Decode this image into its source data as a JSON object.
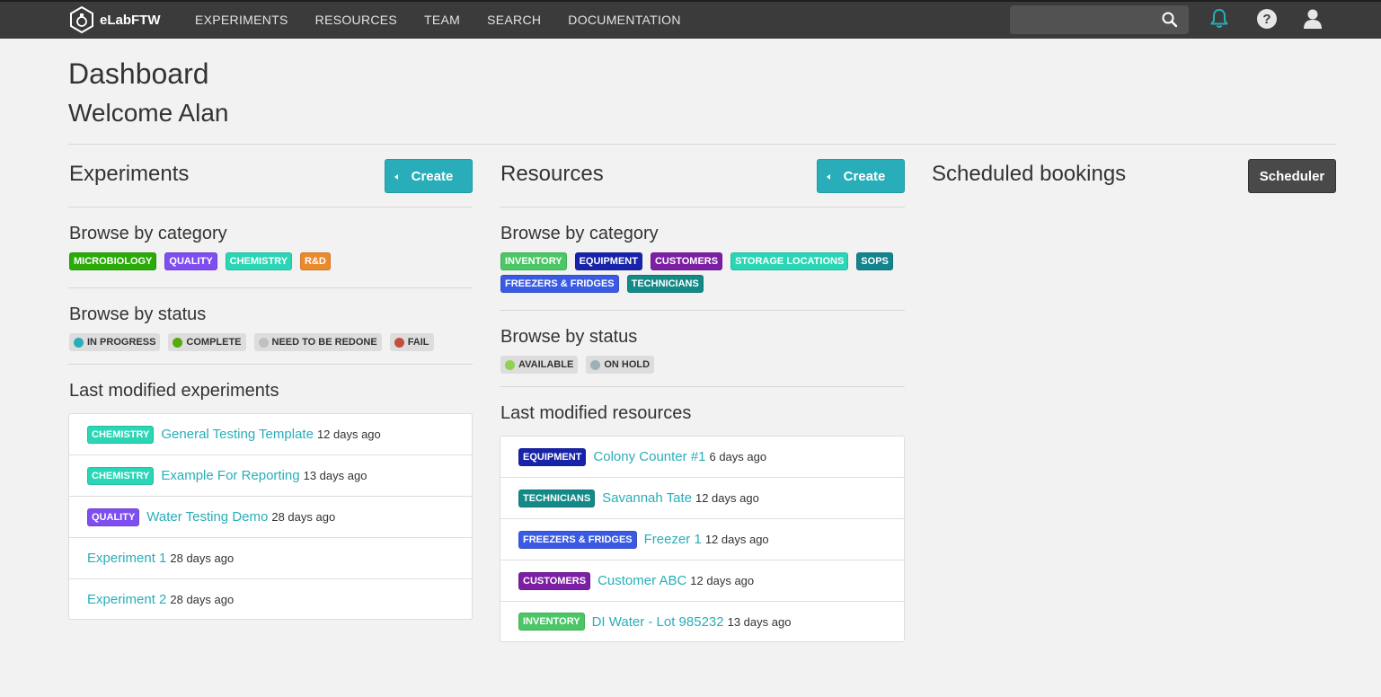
{
  "nav": {
    "brand": "eLabFTW",
    "links": [
      "EXPERIMENTS",
      "RESOURCES",
      "TEAM",
      "SEARCH",
      "DOCUMENTATION"
    ],
    "search_value": "",
    "icons": [
      "search-icon",
      "bell-icon",
      "help-icon",
      "user-icon"
    ]
  },
  "header": {
    "title": "Dashboard",
    "welcome": "Welcome Alan"
  },
  "experiments": {
    "title": "Experiments",
    "create_label": "Create",
    "category_title": "Browse by category",
    "categories": [
      {
        "label": "MICROBIOLOGY",
        "color": "#2bab08"
      },
      {
        "label": "QUALITY",
        "color": "#7f4ef1"
      },
      {
        "label": "CHEMISTRY",
        "color": "#2ad6b5"
      },
      {
        "label": "R&D",
        "color": "#ea8a2d"
      }
    ],
    "status_title": "Browse by status",
    "statuses": [
      {
        "label": "IN PROGRESS",
        "color": "#29aeb9"
      },
      {
        "label": "COMPLETE",
        "color": "#54aa08"
      },
      {
        "label": "NEED TO BE REDONE",
        "color": "#c0c0c0"
      },
      {
        "label": "FAIL",
        "color": "#c24f3d"
      }
    ],
    "last_title": "Last modified experiments",
    "items": [
      {
        "tag": "CHEMISTRY",
        "tag_color": "#2ad6b5",
        "title": "General Testing Template",
        "date": "12 days ago"
      },
      {
        "tag": "CHEMISTRY",
        "tag_color": "#2ad6b5",
        "title": "Example For Reporting",
        "date": "13 days ago"
      },
      {
        "tag": "QUALITY",
        "tag_color": "#7f4ef1",
        "title": "Water Testing Demo",
        "date": "28 days ago"
      },
      {
        "tag": "",
        "tag_color": "",
        "title": "Experiment 1",
        "date": "28 days ago"
      },
      {
        "tag": "",
        "tag_color": "",
        "title": "Experiment 2",
        "date": "28 days ago"
      }
    ]
  },
  "resources": {
    "title": "Resources",
    "create_label": "Create",
    "category_title": "Browse by category",
    "categories": [
      {
        "label": "INVENTORY",
        "color": "#4bc765"
      },
      {
        "label": "EQUIPMENT",
        "color": "#1724a9"
      },
      {
        "label": "CUSTOMERS",
        "color": "#7d1fa3"
      },
      {
        "label": "STORAGE LOCATIONS",
        "color": "#2ad6b5"
      },
      {
        "label": "SOPS",
        "color": "#12848e"
      },
      {
        "label": "FREEZERS & FRIDGES",
        "color": "#3a5ae4"
      },
      {
        "label": "TECHNICIANS",
        "color": "#138a87"
      }
    ],
    "status_title": "Browse by status",
    "statuses": [
      {
        "label": "AVAILABLE",
        "color": "#8fd150"
      },
      {
        "label": "ON HOLD",
        "color": "#9db0ba"
      }
    ],
    "last_title": "Last modified resources",
    "items": [
      {
        "tag": "EQUIPMENT",
        "tag_color": "#1724a9",
        "title": "Colony Counter #1",
        "date": "6 days ago"
      },
      {
        "tag": "TECHNICIANS",
        "tag_color": "#138a87",
        "title": "Savannah Tate",
        "date": "12 days ago"
      },
      {
        "tag": "FREEZERS & FRIDGES",
        "tag_color": "#3a5ae4",
        "title": "Freezer 1",
        "date": "12 days ago"
      },
      {
        "tag": "CUSTOMERS",
        "tag_color": "#7d1fa3",
        "title": "Customer ABC",
        "date": "12 days ago"
      },
      {
        "tag": "INVENTORY",
        "tag_color": "#4bc765",
        "title": "DI Water - Lot 985232",
        "date": "13 days ago"
      }
    ]
  },
  "bookings": {
    "title": "Scheduled bookings",
    "scheduler_label": "Scheduler"
  }
}
